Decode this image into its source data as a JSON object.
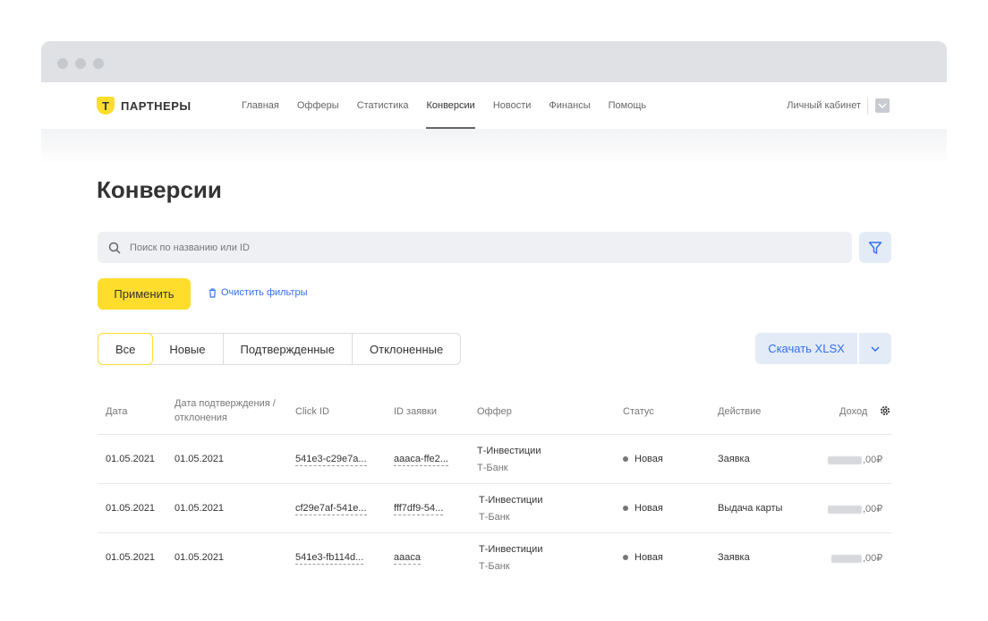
{
  "brand": {
    "logo_letter": "Т",
    "name": "ПАРТНЕРЫ",
    "accent": "#ffdd2d",
    "link_color": "#336fee"
  },
  "nav": {
    "items": [
      {
        "label": "Главная"
      },
      {
        "label": "Офферы"
      },
      {
        "label": "Статистика"
      },
      {
        "label": "Конверсии",
        "active": true
      },
      {
        "label": "Новости"
      },
      {
        "label": "Финансы"
      },
      {
        "label": "Помощь"
      }
    ],
    "account_label": "Личный кабинет"
  },
  "page": {
    "title": "Конверсии"
  },
  "search": {
    "placeholder": "Поиск по названию или ID",
    "value": ""
  },
  "filters": {
    "apply_label": "Применить",
    "clear_label": "Очистить фильтры"
  },
  "tabs": [
    {
      "label": "Все",
      "active": true
    },
    {
      "label": "Новые"
    },
    {
      "label": "Подтвержденные"
    },
    {
      "label": "Отклоненные"
    }
  ],
  "export": {
    "label": "Скачать XLSX"
  },
  "table": {
    "headers": {
      "date": "Дата",
      "confirm_date_1": "Дата подтверждения /",
      "confirm_date_2": "отклонения",
      "click_id": "Click ID",
      "request_id": "ID заявки",
      "offer": "Оффер",
      "status": "Статус",
      "action": "Действие",
      "income": "Доход"
    },
    "rows": [
      {
        "date": "01.05.2021",
        "confirm_date": "01.05.2021",
        "click_id": "541e3-c29e7a...",
        "request_id": "aaaca-ffe2...",
        "offer": "Т-Инвестиции",
        "offer_sub": "Т-Банк",
        "status": "Новая",
        "action": "Заявка",
        "income_suffix": ",00₽"
      },
      {
        "date": "01.05.2021",
        "confirm_date": "01.05.2021",
        "click_id": "cf29e7af-541e...",
        "request_id": "fff7df9-54...",
        "offer": "Т-Инвестиции",
        "offer_sub": "Т-Банк",
        "status": "Новая",
        "action": "Выдача карты",
        "income_suffix": ",00₽"
      },
      {
        "date": "01.05.2021",
        "confirm_date": "01.05.2021",
        "click_id": "541e3-fb114d...",
        "request_id": "aaaca",
        "offer": "Т-Инвестиции",
        "offer_sub": "Т-Банк",
        "status": "Новая",
        "action": "Заявка",
        "income_suffix": ",00₽"
      }
    ]
  }
}
